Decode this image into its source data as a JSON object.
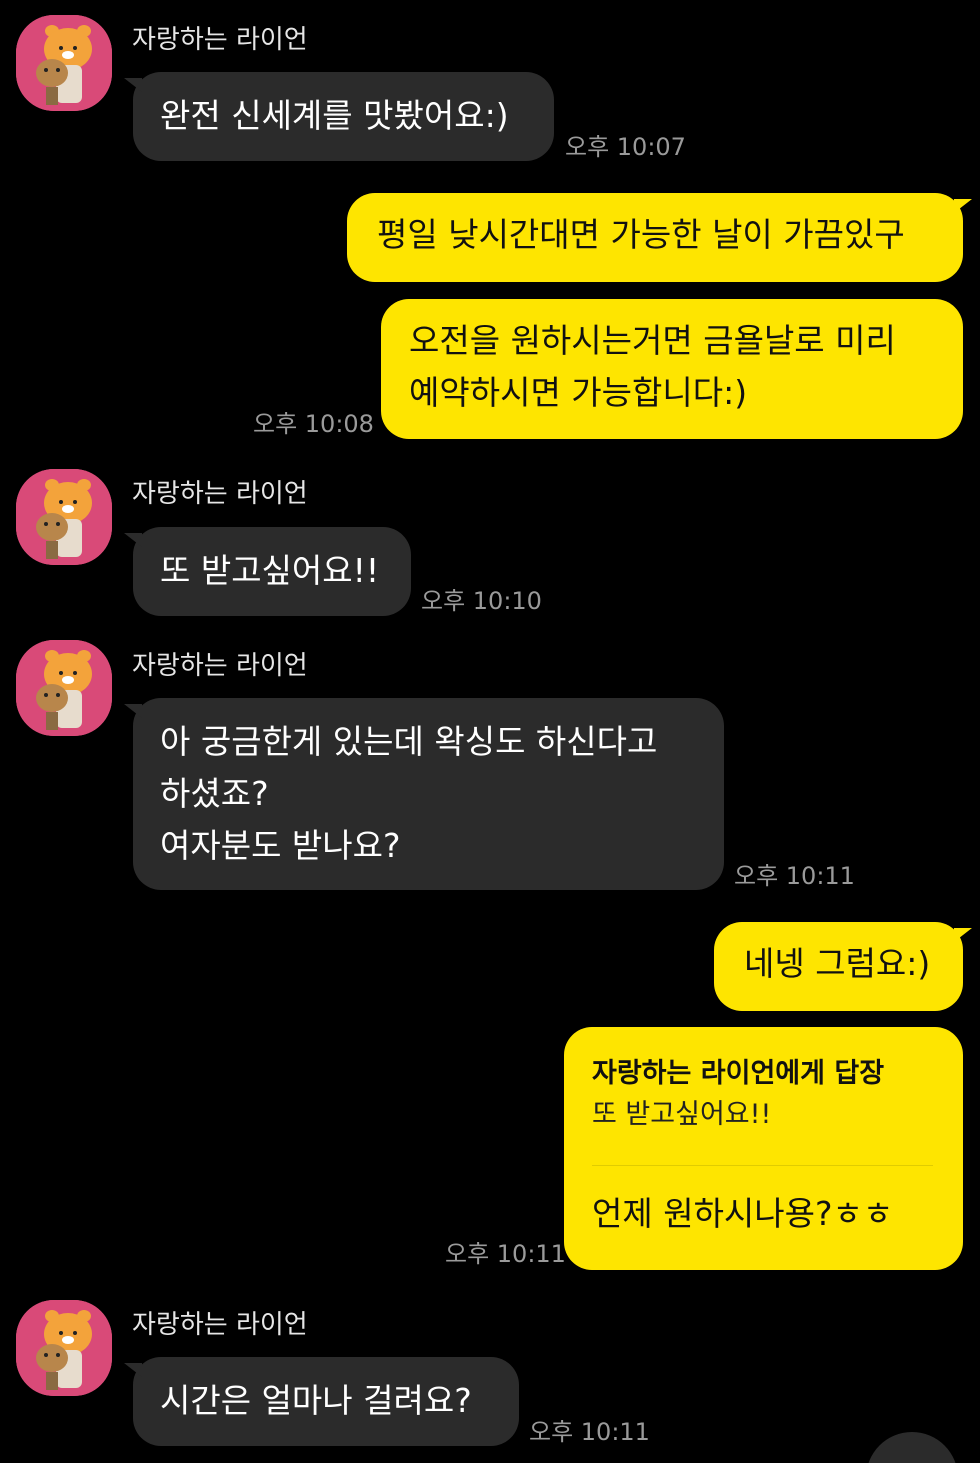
{
  "sender_name": "자랑하는 라이언",
  "messages": {
    "m1": {
      "text": "완전 신세계를 맛봤어요:)",
      "time": "오후 10:07"
    },
    "m2": {
      "text": "평일 낮시간대면 가능한 날이 가끔있구"
    },
    "m3": {
      "line1": "오전을 원하시는거면 금욜날로 미리",
      "line2": "예약하시면 가능합니다:)",
      "time": "오후 10:08"
    },
    "m4": {
      "text": "또 받고싶어요!!",
      "time": "오후 10:10"
    },
    "m5": {
      "line1": "아 궁금한게 있는데 왁싱도 하신다고",
      "line2": "하셨죠?",
      "line3": "여자분도 받나요?",
      "time": "오후 10:11"
    },
    "m6": {
      "text": "네넹 그럼요:)"
    },
    "m7": {
      "reply_header": "자랑하는 라이언에게 답장",
      "reply_quote": "또 받고싶어요!!",
      "text": "언제 원하시나용?ㅎㅎ",
      "time": "오후 10:11"
    },
    "m8": {
      "text": "시간은 얼마나 걸려요?",
      "time": "오후 10:11"
    }
  },
  "colors": {
    "background": "#000000",
    "incoming_bubble": "#2b2b2b",
    "outgoing_bubble": "#fee500",
    "avatar_bg": "#d94a78"
  },
  "icons": {
    "avatar": "ryan-character-icon",
    "scroll": "scroll-down-button"
  }
}
